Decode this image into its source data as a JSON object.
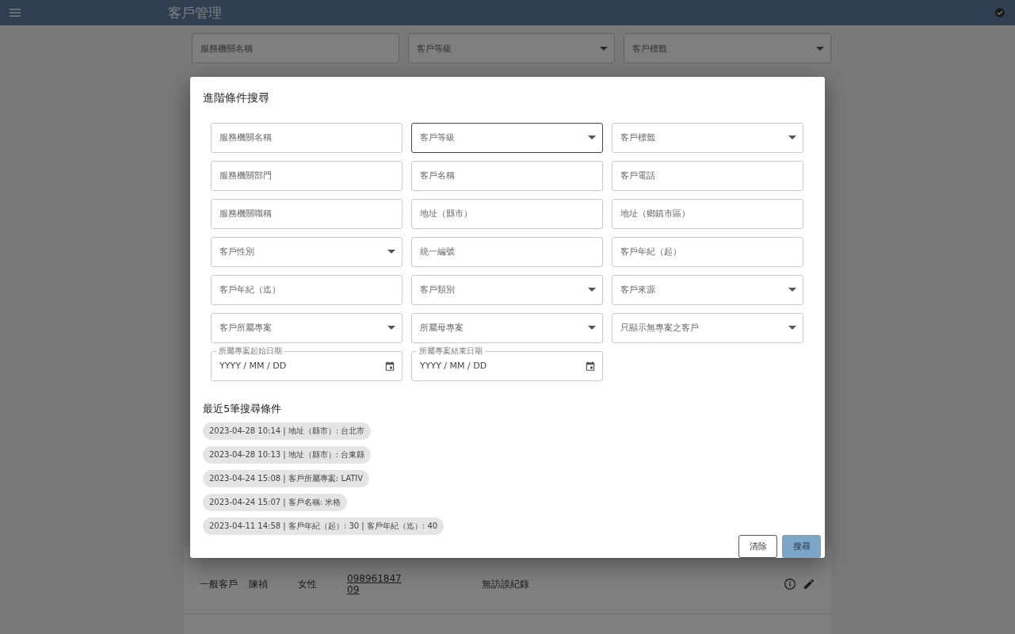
{
  "app_bar": {
    "title": "客戶管理"
  },
  "background_filters": [
    {
      "label": "服務機關名稱",
      "kind": "text"
    },
    {
      "label": "客戶等級",
      "kind": "select"
    },
    {
      "label": "客戶標籤",
      "kind": "select"
    }
  ],
  "background_row": {
    "cells": [
      "一般客戶",
      "陳禎",
      "女性"
    ],
    "phone": "098961847\n09",
    "note": "無訪談紀錄"
  },
  "dialog": {
    "title": "進階條件搜尋",
    "fields": [
      {
        "label": "服務機關名稱",
        "kind": "text",
        "focused": false
      },
      {
        "label": "客戶等級",
        "kind": "select",
        "focused": true
      },
      {
        "label": "客戶標籤",
        "kind": "select",
        "focused": false
      },
      {
        "label": "服務機關部門",
        "kind": "text",
        "focused": false
      },
      {
        "label": "客戶名稱",
        "kind": "text",
        "focused": false
      },
      {
        "label": "客戶電話",
        "kind": "text",
        "focused": false
      },
      {
        "label": "服務機關職稱",
        "kind": "text",
        "focused": false
      },
      {
        "label": "地址（縣市）",
        "kind": "text",
        "focused": false
      },
      {
        "label": "地址（鄉鎮市區）",
        "kind": "text",
        "focused": false
      },
      {
        "label": "客戶性別",
        "kind": "select",
        "focused": false
      },
      {
        "label": "統一編號",
        "kind": "text",
        "focused": false
      },
      {
        "label": "客戶年紀（起）",
        "kind": "text",
        "focused": false
      },
      {
        "label": "客戶年紀（迄）",
        "kind": "text",
        "focused": false
      },
      {
        "label": "客戶類別",
        "kind": "select",
        "focused": false
      },
      {
        "label": "客戶來源",
        "kind": "select",
        "focused": false
      },
      {
        "label": "客戶所屬專案",
        "kind": "select",
        "focused": false
      },
      {
        "label": "所屬母專案",
        "kind": "select",
        "focused": false
      },
      {
        "label": "只顯示無專案之客戶",
        "kind": "select",
        "focused": false
      },
      {
        "label": "所屬專案起始日期",
        "kind": "date",
        "placeholder": "YYYY / MM / DD",
        "focused": false
      },
      {
        "label": "所屬專案結束日期",
        "kind": "date",
        "placeholder": "YYYY / MM / DD",
        "focused": false
      }
    ],
    "history_title": "最近5筆搜尋條件",
    "history": [
      "2023-04-28 10:14 | 地址（縣市）: 台北市",
      "2023-04-28 10:13 | 地址（縣市）: 台東縣",
      "2023-04-24 15:08 | 客戶所屬專案: LATIV",
      "2023-04-24 15:07 | 客戶名稱: 米格",
      "2023-04-11 14:58 | 客戶年紀（起）: 30 | 客戶年紀（迄）: 40"
    ],
    "buttons": [
      {
        "label": "清除",
        "kind": "outlined"
      },
      {
        "label": "搜尋",
        "kind": "primary"
      }
    ]
  }
}
